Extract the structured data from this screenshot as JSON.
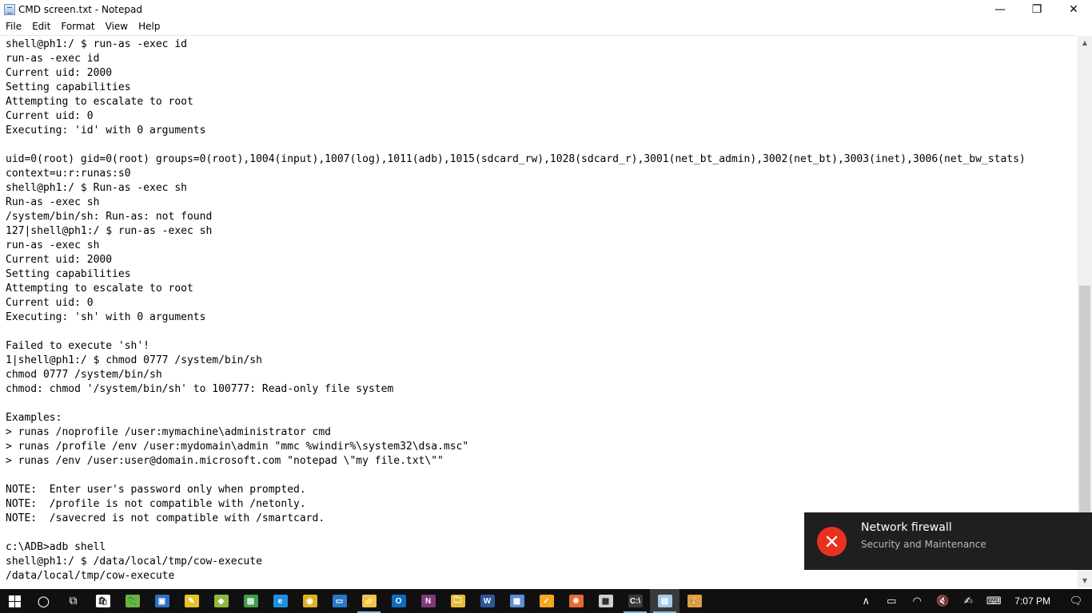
{
  "window": {
    "title": "CMD screen.txt - Notepad",
    "minimize_glyph": "—",
    "maximize_glyph": "❐",
    "close_glyph": "✕"
  },
  "menu": [
    "File",
    "Edit",
    "Format",
    "View",
    "Help"
  ],
  "editor": {
    "lines": [
      "shell@ph1:/ $ run-as -exec id",
      "run-as -exec id",
      "Current uid: 2000",
      "Setting capabilities",
      "Attempting to escalate to root",
      "Current uid: 0",
      "Executing: 'id' with 0 arguments",
      "",
      "uid=0(root) gid=0(root) groups=0(root),1004(input),1007(log),1011(adb),1015(sdcard_rw),1028(sdcard_r),3001(net_bt_admin),3002(net_bt),3003(inet),3006(net_bw_stats)",
      "context=u:r:runas:s0",
      "shell@ph1:/ $ Run-as -exec sh",
      "Run-as -exec sh",
      "/system/bin/sh: Run-as: not found",
      "127|shell@ph1:/ $ run-as -exec sh",
      "run-as -exec sh",
      "Current uid: 2000",
      "Setting capabilities",
      "Attempting to escalate to root",
      "Current uid: 0",
      "Executing: 'sh' with 0 arguments",
      "",
      "Failed to execute 'sh'!",
      "1|shell@ph1:/ $ chmod 0777 /system/bin/sh",
      "chmod 0777 /system/bin/sh",
      "chmod: chmod '/system/bin/sh' to 100777: Read-only file system",
      "",
      "Examples:",
      "> runas /noprofile /user:mymachine\\administrator cmd",
      "> runas /profile /env /user:mydomain\\admin \"mmc %windir%\\system32\\dsa.msc\"",
      "> runas /env /user:user@domain.microsoft.com \"notepad \\\"my file.txt\\\"\"",
      "",
      "NOTE:  Enter user's password only when prompted.",
      "NOTE:  /profile is not compatible with /netonly.",
      "NOTE:  /savecred is not compatible with /smartcard.",
      "",
      "c:\\ADB>adb shell",
      "shell@ph1:/ $ /data/local/tmp/cow-execute",
      "/data/local/tmp/cow-execute"
    ]
  },
  "scrollbar": {
    "up_glyph": "▲",
    "down_glyph": "▼",
    "position_fraction": 0.45
  },
  "toast": {
    "icon_glyph": "✕",
    "title": "Network firewall",
    "subtitle": "Security and Maintenance",
    "accent_color": "#e8321f"
  },
  "taskbar": {
    "items": [
      {
        "name": "cortana-search-icon",
        "glyph": "○"
      },
      {
        "name": "task-view-icon",
        "glyph": "⧉"
      },
      {
        "name": "store-icon",
        "glyph": "🛍"
      },
      {
        "name": "app-lizard-icon",
        "glyph": "🦎"
      },
      {
        "name": "app-blue-icon",
        "glyph": "▣"
      },
      {
        "name": "app-tools-icon",
        "glyph": "✎"
      },
      {
        "name": "app-cube-icon",
        "glyph": "◆"
      },
      {
        "name": "app-terminal-icon",
        "glyph": "▤"
      },
      {
        "name": "edge-icon",
        "glyph": "e"
      },
      {
        "name": "chrome-icon",
        "glyph": "◉"
      },
      {
        "name": "app-monitor-icon",
        "glyph": "▭"
      },
      {
        "name": "file-explorer-icon",
        "glyph": "📁"
      },
      {
        "name": "outlook-icon",
        "glyph": "O"
      },
      {
        "name": "onenote-icon",
        "glyph": "N"
      },
      {
        "name": "app-folder-icon",
        "glyph": "🗀"
      },
      {
        "name": "word-icon",
        "glyph": "W"
      },
      {
        "name": "app-document-icon",
        "glyph": "▦"
      },
      {
        "name": "app-check-icon",
        "glyph": "✓"
      },
      {
        "name": "app-gear-icon",
        "glyph": "✹"
      },
      {
        "name": "calculator-icon",
        "glyph": "▦"
      },
      {
        "name": "cmd-icon",
        "glyph": "C:\\"
      },
      {
        "name": "notepad-icon",
        "glyph": "▤"
      },
      {
        "name": "paint-icon",
        "glyph": "🎨"
      }
    ],
    "tray": [
      {
        "name": "show-hidden-icons-icon",
        "glyph": "∧"
      },
      {
        "name": "battery-icon",
        "glyph": "▭"
      },
      {
        "name": "wifi-icon",
        "glyph": "◠"
      },
      {
        "name": "volume-muted-icon",
        "glyph": "🔇"
      },
      {
        "name": "pen-icon",
        "glyph": "✍"
      },
      {
        "name": "keyboard-icon",
        "glyph": "⌨"
      }
    ],
    "clock": "7:07 PM",
    "notification_glyph": "🗨"
  }
}
